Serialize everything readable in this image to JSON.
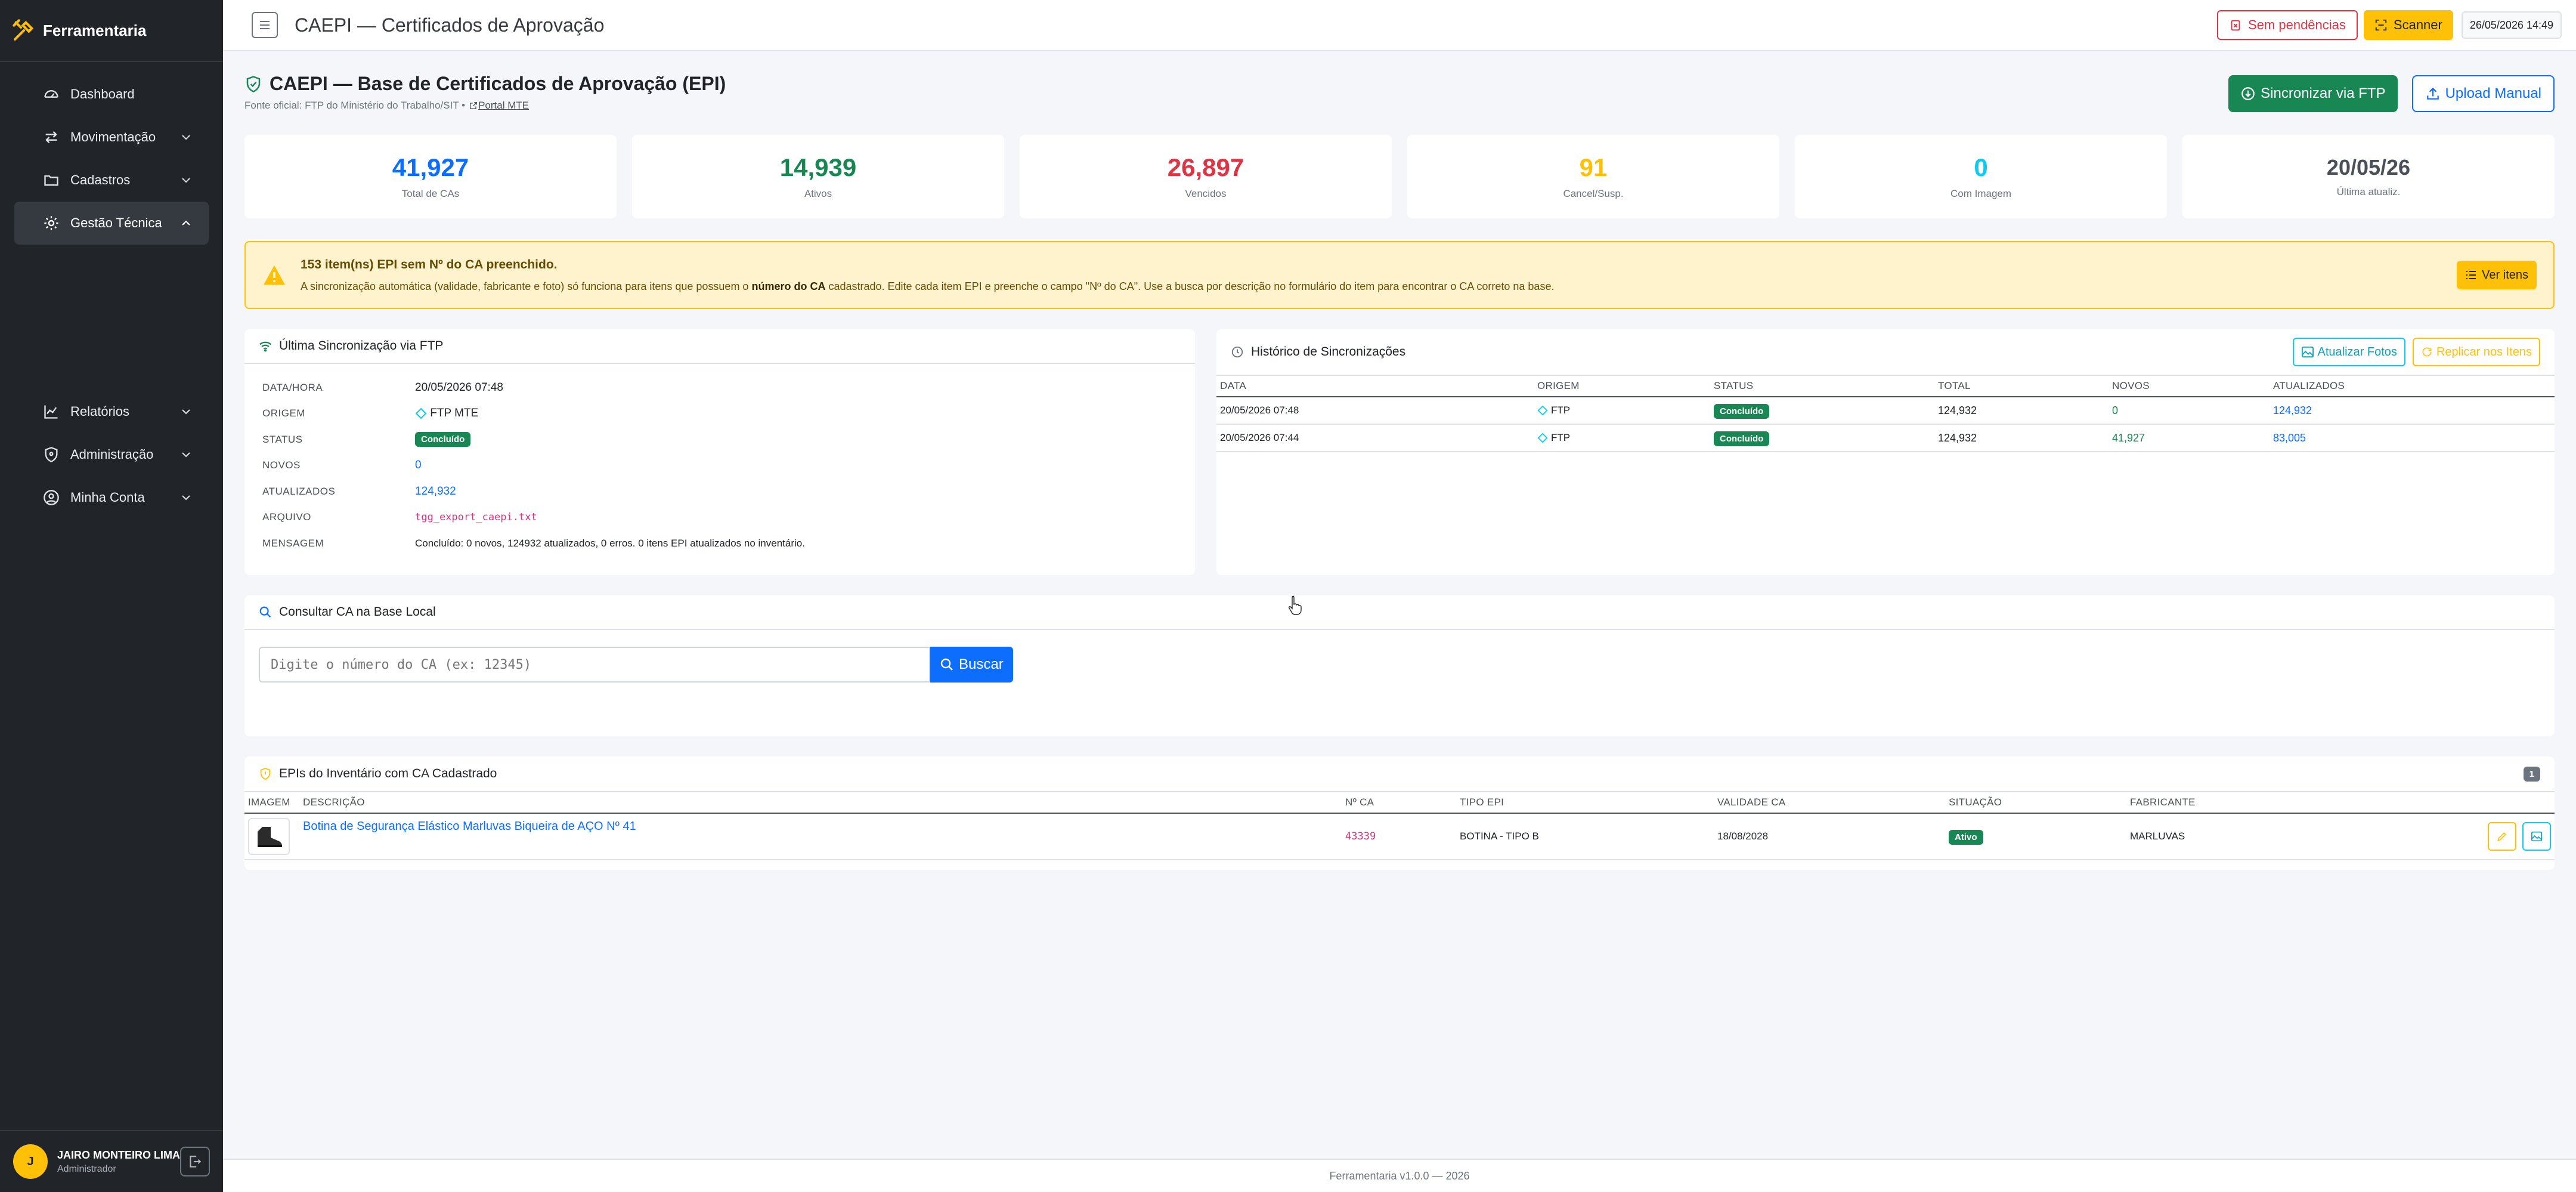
{
  "app": {
    "brand": "Ferramentaria"
  },
  "sidebar": {
    "items": [
      {
        "label": "Dashboard",
        "icon": "gauge-icon"
      },
      {
        "label": "Movimentação",
        "icon": "arrows-exchange-icon"
      },
      {
        "label": "Cadastros",
        "icon": "folder-icon"
      },
      {
        "label": "Gestão Técnica",
        "icon": "gear-icon"
      },
      {
        "label": "Relatórios",
        "icon": "chart-line-icon"
      },
      {
        "label": "Administração",
        "icon": "shield-icon"
      },
      {
        "label": "Minha Conta",
        "icon": "person-circle-icon"
      }
    ],
    "user": {
      "initial": "J",
      "name": "JAIRO MONTEIRO LIMA",
      "role": "Administrador"
    }
  },
  "topbar": {
    "title": "CAEPI — Certificados de Aprovação",
    "pending_label": "Sem pendências",
    "scanner_label": "Scanner",
    "datetime": "26/05/2026 14:49"
  },
  "header": {
    "title": "CAEPI — Base de Certificados de Aprovação (EPI)",
    "source_text": "Fonte oficial: FTP do Ministério do Trabalho/SIT •",
    "portal_link": "Portal MTE",
    "sync_button": "Sincronizar via FTP",
    "upload_button": "Upload Manual"
  },
  "colors": {
    "primary": "#0d6efd",
    "success": "#198754",
    "danger": "#dc3545",
    "warning": "#ffc107",
    "info": "#0dcaf0",
    "sidebar": "#212529"
  },
  "stats": [
    {
      "value": "41,927",
      "label": "Total de CAs",
      "color": "#0d6efd"
    },
    {
      "value": "14,939",
      "label": "Ativos",
      "color": "#198754"
    },
    {
      "value": "26,897",
      "label": "Vencidos",
      "color": "#dc3545"
    },
    {
      "value": "91",
      "label": "Cancel/Susp.",
      "color": "#ffc107"
    },
    {
      "value": "0",
      "label": "Com Imagem",
      "color": "#0dcaf0"
    },
    {
      "value": "20/05/26",
      "label": "Última atualiz.",
      "color": "#495057"
    }
  ],
  "alert": {
    "title": "153 item(ns) EPI sem Nº do CA preenchido.",
    "text_1": "A sincronização automática (validade, fabricante e foto) só funciona para itens que possuem o ",
    "text_bold": "número do CA",
    "text_2": " cadastrado. Edite cada item EPI e preenche o campo \"Nº do CA\". Use a busca por descrição no formulário do item para encontrar o CA correto na base.",
    "button": "Ver itens"
  },
  "last_sync": {
    "title": "Última Sincronização via FTP",
    "rows": [
      {
        "key": "DATA/HORA",
        "value": "20/05/2026 07:48"
      },
      {
        "key": "ORIGEM",
        "value": "FTP MTE"
      },
      {
        "key": "STATUS",
        "value": "Concluído"
      },
      {
        "key": "NOVOS",
        "value": "0"
      },
      {
        "key": "ATUALIZADOS",
        "value": "124,932"
      },
      {
        "key": "ARQUIVO",
        "value": "tgg_export_caepi.txt"
      },
      {
        "key": "MENSAGEM",
        "value": "Concluído: 0 novos, 124932 atualizados, 0 erros. 0 itens EPI atualizados no inventário."
      }
    ]
  },
  "history": {
    "title": "Histórico de Sincronizações",
    "refresh_photos": "Atualizar Fotos",
    "replicate": "Replicar nos Itens",
    "columns": [
      "DATA",
      "ORIGEM",
      "STATUS",
      "TOTAL",
      "NOVOS",
      "ATUALIZADOS"
    ],
    "rows": [
      {
        "date": "20/05/2026 07:48",
        "origin": "FTP",
        "status": "Concluído",
        "total": "124,932",
        "new": "0",
        "updated": "124,932"
      },
      {
        "date": "20/05/2026 07:44",
        "origin": "FTP",
        "status": "Concluído",
        "total": "124,932",
        "new": "41,927",
        "updated": "83,005"
      }
    ]
  },
  "lookup": {
    "title": "Consultar CA na Base Local",
    "placeholder": "Digite o número do CA (ex: 12345)",
    "button": "Buscar"
  },
  "inventory": {
    "title": "EPIs do Inventário com CA Cadastrado",
    "count": "1",
    "columns": [
      "IMAGEM",
      "DESCRIÇÃO",
      "Nº CA",
      "TIPO EPI",
      "VALIDADE CA",
      "SITUAÇÃO",
      "FABRICANTE"
    ],
    "rows": [
      {
        "description": "Botina de Segurança Elástico Marluvas Biqueira de AÇO Nº 41",
        "ca": "43339",
        "type": "BOTINA - TIPO B",
        "validity": "18/08/2028",
        "status": "Ativo",
        "manufacturer": "MARLUVAS"
      }
    ]
  },
  "footer": {
    "text": "Ferramentaria v1.0.0 — 2026"
  }
}
